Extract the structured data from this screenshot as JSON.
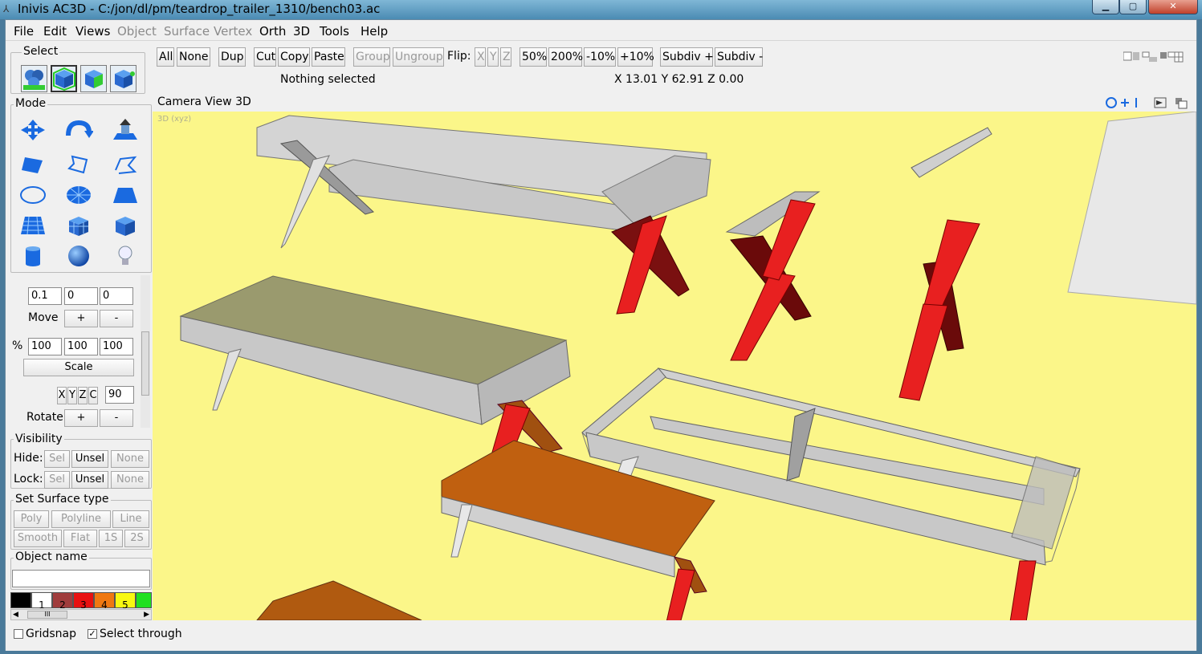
{
  "window": {
    "title": "Inivis AC3D - C:/jon/dl/pm/teardrop_trailer_1310/bench03.ac",
    "min_glyph": "▁",
    "max_glyph": "▢",
    "close_glyph": "✕"
  },
  "menu": [
    "File",
    "Edit",
    "Views",
    "Object",
    "Surface",
    "Vertex",
    "Orth",
    "3D",
    "Tools",
    "Help"
  ],
  "toolbar": {
    "all": "All",
    "none": "None",
    "dup": "Dup",
    "cut": "Cut",
    "copy": "Copy",
    "paste": "Paste",
    "group": "Group",
    "ungroup": "Ungroup",
    "flip_label": "Flip:",
    "flip_x": "X",
    "flip_y": "Y",
    "flip_z": "Z",
    "z50": "50%",
    "z200": "200%",
    "m10": "-10%",
    "p10": "+10%",
    "subdiv_plus": "Subdiv +",
    "subdiv_minus": "Subdiv -"
  },
  "status": {
    "selection": "Nothing selected",
    "coords": "X 13.01 Y 62.91 Z 0.00"
  },
  "panel": {
    "select_label": "Select",
    "mode_label": "Mode",
    "step": [
      "0.1",
      "0",
      "0"
    ],
    "move_label": "Move",
    "plus": "+",
    "minus": "-",
    "pct_label": "%",
    "scale_vals": [
      "100",
      "100",
      "100"
    ],
    "scale_label": "Scale",
    "axes": [
      "X",
      "Y",
      "Z",
      "C"
    ],
    "angle": "90",
    "rotate_label": "Rotate",
    "visibility_label": "Visibility",
    "hide_label": "Hide:",
    "lock_label": "Lock:",
    "sel": "Sel",
    "unsel": "Unsel",
    "vnone": "None",
    "surface_label": "Set Surface type",
    "poly": "Poly",
    "polyline": "Polyline",
    "line": "Line",
    "smooth": "Smooth",
    "flat": "Flat",
    "s1": "1S",
    "s2": "2S",
    "objname_label": "Object name",
    "palette": [
      {
        "n": "",
        "c": "#000000"
      },
      {
        "n": "1",
        "c": "#ffffff"
      },
      {
        "n": "2",
        "c": "#a03c3c"
      },
      {
        "n": "3",
        "c": "#e81010"
      },
      {
        "n": "4",
        "c": "#f07810"
      },
      {
        "n": "5",
        "c": "#f8f810"
      },
      {
        "n": "",
        "c": "#20e020"
      }
    ],
    "hscroll": "III"
  },
  "viewport": {
    "header": "Camera  View  3D",
    "label": "3D (xyz)"
  },
  "bottom": {
    "gridsnap": "Gridsnap",
    "select_through": "Select through"
  }
}
